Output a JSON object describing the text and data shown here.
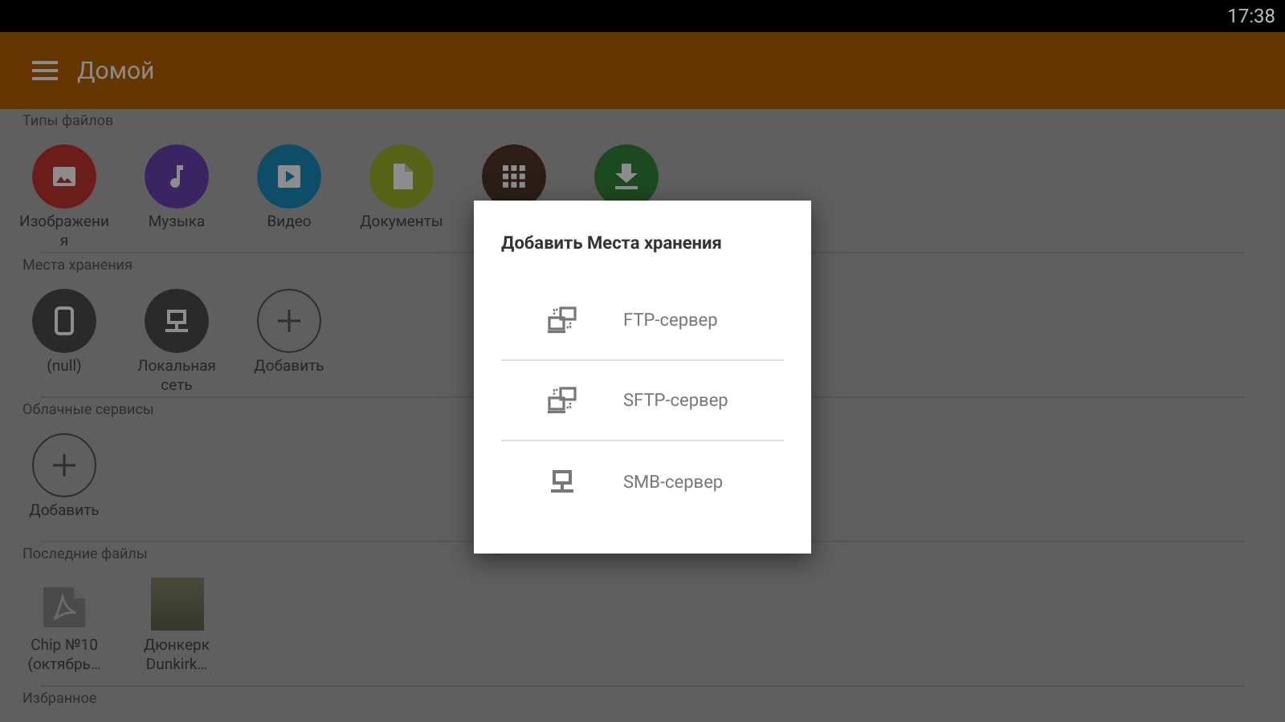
{
  "status_bar": {
    "time": "17:38"
  },
  "app_bar": {
    "title": "Домой"
  },
  "sections": [
    {
      "title": "Типы файлов",
      "items": [
        {
          "kind": "image",
          "label": "Изображения",
          "color": "#6c1d1a"
        },
        {
          "kind": "music",
          "label": "Музыка",
          "color": "#3b2462"
        },
        {
          "kind": "video",
          "label": "Видео",
          "color": "#0d4d68"
        },
        {
          "kind": "document",
          "label": "Документы",
          "color": "#566215"
        },
        {
          "kind": "apps",
          "color": "#2c1d17"
        },
        {
          "kind": "download",
          "color": "#1c4a1f"
        }
      ]
    },
    {
      "title": "Места хранения",
      "items": [
        {
          "kind": "device",
          "label": "(null)"
        },
        {
          "kind": "network",
          "label": "Локальная сеть"
        },
        {
          "kind": "add",
          "label": "Добавить"
        }
      ]
    },
    {
      "title": "Облачные сервисы",
      "items": [
        {
          "kind": "add",
          "label": "Добавить"
        }
      ]
    },
    {
      "title": "Последние файлы",
      "items": [
        {
          "kind": "pdf",
          "label": "Chip №10 (октябрь…"
        },
        {
          "kind": "photo",
          "label": "Дюнкерк Dunkirk…"
        }
      ]
    },
    {
      "title": "Избранное"
    }
  ],
  "dialog": {
    "title": "Добавить Места хранения",
    "options": [
      {
        "kind": "ftp",
        "label": "FTP-сервер"
      },
      {
        "kind": "sftp",
        "label": "SFTP-сервер"
      },
      {
        "kind": "smb",
        "label": "SMB-сервер"
      }
    ]
  }
}
